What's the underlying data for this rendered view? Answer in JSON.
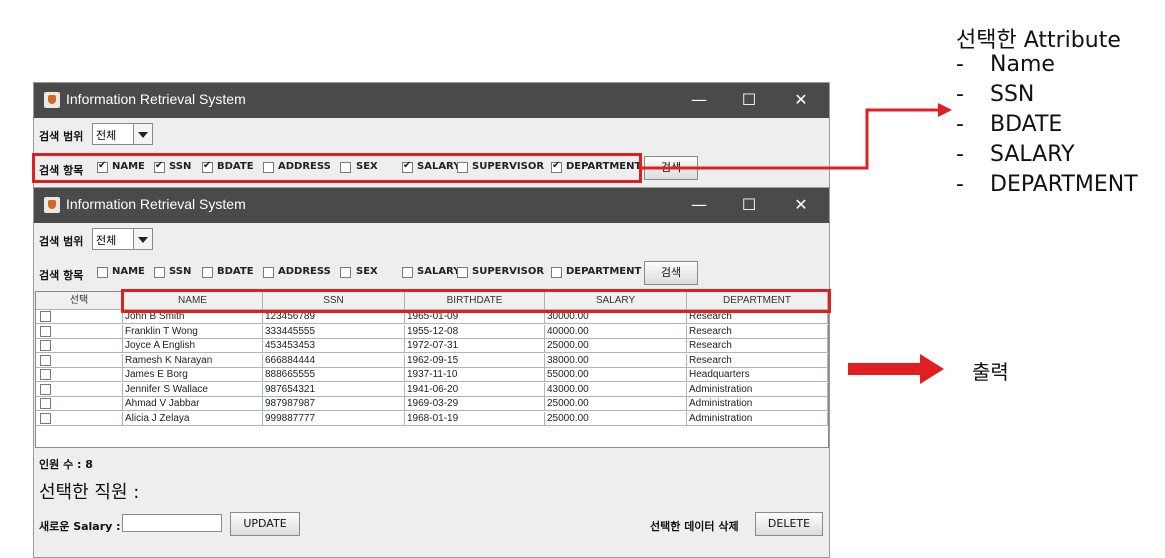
{
  "window": {
    "title": "Information Retrieval System"
  },
  "controls": {
    "scope_label": "검색 범위",
    "scope_value": "전체",
    "attr_label": "검색 항목",
    "search_button": "검색"
  },
  "attributes": [
    "NAME",
    "SSN",
    "BDATE",
    "ADDRESS",
    "SEX",
    "SALARY",
    "SUPERVISOR",
    "DEPARTMENT"
  ],
  "top_checked": [
    true,
    true,
    true,
    false,
    false,
    true,
    false,
    true
  ],
  "bottom_checked": [
    false,
    false,
    false,
    false,
    false,
    false,
    false,
    false
  ],
  "table": {
    "select_header": "선택",
    "columns": [
      "NAME",
      "SSN",
      "BIRTHDATE",
      "SALARY",
      "DEPARTMENT"
    ],
    "rows": [
      [
        "John B Smith",
        "123456789",
        "1965-01-09",
        "30000.00",
        "Research"
      ],
      [
        "Franklin T Wong",
        "333445555",
        "1955-12-08",
        "40000.00",
        "Research"
      ],
      [
        "Joyce A English",
        "453453453",
        "1972-07-31",
        "25000.00",
        "Research"
      ],
      [
        "Ramesh K Narayan",
        "666884444",
        "1962-09-15",
        "38000.00",
        "Research"
      ],
      [
        "James E Borg",
        "888665555",
        "1937-11-10",
        "55000.00",
        "Headquarters"
      ],
      [
        "Jennifer S Wallace",
        "987654321",
        "1941-06-20",
        "43000.00",
        "Administration"
      ],
      [
        "Ahmad V Jabbar",
        "987987987",
        "1969-03-29",
        "25000.00",
        "Administration"
      ],
      [
        "Alicia J Zelaya",
        "999887777",
        "1968-01-19",
        "25000.00",
        "Administration"
      ]
    ]
  },
  "footer": {
    "count_label": "인원 수 : 8",
    "selected_label": "선택한 직원 :",
    "salary_label": "새로운 Salary :",
    "salary_value": "",
    "update_button": "UPDATE",
    "delete_label": "선택한 데이터 삭제",
    "delete_button": "DELETE"
  },
  "annotation": {
    "selected_title": "선택한 Attribute",
    "selected_items": [
      "Name",
      "SSN",
      "BDATE",
      "SALARY",
      "DEPARTMENT"
    ],
    "bullet": "-",
    "output_label": "출력"
  },
  "colors": {
    "titlebar": "#4a4a4a",
    "highlight": "#e02020"
  }
}
